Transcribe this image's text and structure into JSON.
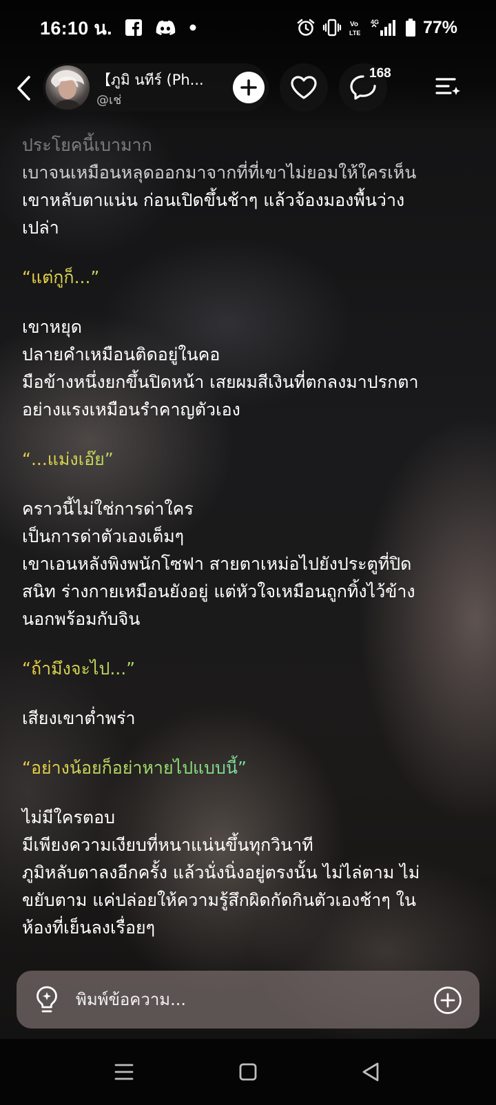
{
  "status_bar": {
    "time": "16:10 น.",
    "battery": "77%",
    "icons": [
      "facebook-icon",
      "discord-icon",
      "dot-icon",
      "alarm-icon",
      "vibrate-icon",
      "volte-icon",
      "signal-4g-icon",
      "battery-icon"
    ]
  },
  "header": {
    "character_name": "【ภูมิ นทีร์ (Ph...",
    "handle": "@เช่",
    "comment_count": "168",
    "icons": [
      "back-icon",
      "plus-icon",
      "heart-icon",
      "comment-icon",
      "menu-sparkle-icon"
    ]
  },
  "story": {
    "lines": [
      "ประโยคนี้เบามาก",
      "เบาจนเหมือนหลุดออกมาจากที่ที่เขาไม่ยอมให้ใครเห็น",
      "เขาหลับตาแน่น ก่อนเปิดขึ้นช้าๆ แล้วจ้องมองพื้นว่าง",
      "เปล่า",
      "“แต่กูก็...”",
      "เขาหยุด",
      "ปลายคำเหมือนติดอยู่ในคอ",
      "มือข้างหนึ่งยกขึ้นปิดหน้า เสยผมสีเงินที่ตกลงมาปรกตา",
      "อย่างแรงเหมือนรำคาญตัวเอง",
      "“...แม่งเอ๊ย”",
      "คราวนี้ไม่ใช่การด่าใคร",
      "เป็นการด่าตัวเองเต็มๆ",
      "เขาเอนหลังพิงพนักโซฟา สายตาเหม่อไปยังประตูที่ปิด",
      "สนิท ร่างกายเหมือนยังอยู่ แต่หัวใจเหมือนถูกทิ้งไว้ข้าง",
      "นอกพร้อมกับจิน",
      "“ถ้ามึงจะไป...”",
      "เสียงเขาต่ำพร่า",
      "“อย่างน้อยก็อย่าหายไปแบบนี้”",
      "ไม่มีใครตอบ",
      "มีเพียงความเงียบที่หนาแน่นขึ้นทุกวินาที",
      "ภูมิหลับตาลงอีกครั้ง แล้วนั่งนิ่งอยู่ตรงนั้น ไม่ไล่ตาม ไม่",
      "ขยับตาม แค่ปล่อยให้ความรู้สึกผิดกัดกินตัวเองช้าๆ ใน",
      "ห้องที่เย็นลงเรื่อยๆ"
    ]
  },
  "input": {
    "placeholder": "พิมพ์ข้อความ...",
    "value": "",
    "icons": [
      "lightbulb-icon",
      "plus-circle-icon"
    ]
  },
  "nav_bar": {
    "icons": [
      "recents-icon",
      "home-icon",
      "back-triangle-icon"
    ]
  },
  "colors": {
    "dialog_gradient": [
      "#f4d03f",
      "#8ee07a",
      "#4fd1e8",
      "#6fb6ff"
    ],
    "input_bar": "#786e6c",
    "pill_background": "#141416"
  }
}
